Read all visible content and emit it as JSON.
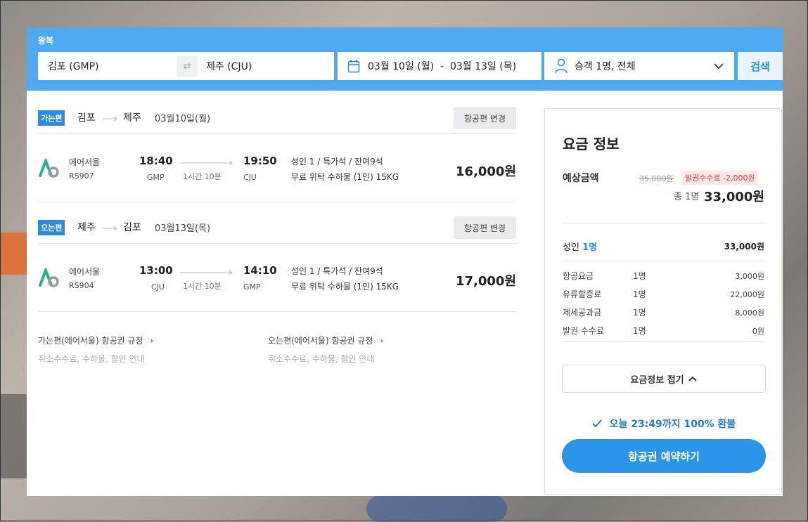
{
  "search": {
    "trip_type": "왕복",
    "from": "김포 (GMP)",
    "to": "제주 (CJU)",
    "dates": "03월 10일 (월)  -  03월 13일 (목)",
    "passengers": "승객 1명, 전체",
    "search_label": "검색"
  },
  "segments": [
    {
      "badge": "가는편",
      "from": "김포",
      "to": "제주",
      "date": "03월10일(월)",
      "change_label": "항공편 변경",
      "airline": "에어서울",
      "flight_no": "RS907",
      "dep_time": "18:40",
      "dep_airport": "GMP",
      "duration": "1시간 10분",
      "arr_time": "19:50",
      "arr_airport": "CJU",
      "info1": "성인 1 / 특가석 / 잔여9석",
      "info2": "무료 위탁 수하물 (1인) 15KG",
      "price": "16,000원"
    },
    {
      "badge": "오는편",
      "from": "제주",
      "to": "김포",
      "date": "03월13일(목)",
      "change_label": "항공편 변경",
      "airline": "에어서울",
      "flight_no": "RS904",
      "dep_time": "13:00",
      "dep_airport": "CJU",
      "duration": "1시간 10분",
      "arr_time": "14:10",
      "arr_airport": "GMP",
      "info1": "성인 1 / 특가석 / 잔여9석",
      "info2": "무료 위탁 수하물 (1인) 15KG",
      "price": "17,000원"
    }
  ],
  "rules": [
    {
      "title": "가는편(에어서울) 항공권 규정",
      "sub": "취소수수료, 수하물, 할인 안내"
    },
    {
      "title": "오는편(에어서울) 항공권 규정",
      "sub": "취소수수료, 수하물, 할인 안내"
    }
  ],
  "fare": {
    "title": "요금 정보",
    "est_label": "예상금액",
    "orig_price": "35,000원",
    "discount": "발권수수료 -2,000원",
    "total_label": "총 1명",
    "total_price": "33,000원",
    "adult_label": "성인",
    "adult_count": "1명",
    "adult_total": "33,000원",
    "breakdown": [
      {
        "name": "항공요금",
        "qty": "1명",
        "amount": "3,000원"
      },
      {
        "name": "유류할증료",
        "qty": "1명",
        "amount": "22,000원"
      },
      {
        "name": "제세공과금",
        "qty": "1명",
        "amount": "8,000원"
      },
      {
        "name": "발권 수수료",
        "qty": "1명",
        "amount": "0원"
      }
    ],
    "fold_label": "요금정보 접기",
    "refund_text": "오늘 23:49까지 100% 환불",
    "book_label": "항공권 예약하기"
  },
  "colors": {
    "accent": "#2b95ea",
    "header": "#4ea9f2",
    "badge": "#2b8ae5",
    "discount": "#e03a3a"
  },
  "icons": [
    "swap-icon",
    "calendar-icon",
    "person-icon",
    "chevron-down-icon",
    "arrow-right-icon",
    "airline-logo-icon",
    "chevron-right-icon",
    "chevron-up-icon",
    "check-icon"
  ]
}
